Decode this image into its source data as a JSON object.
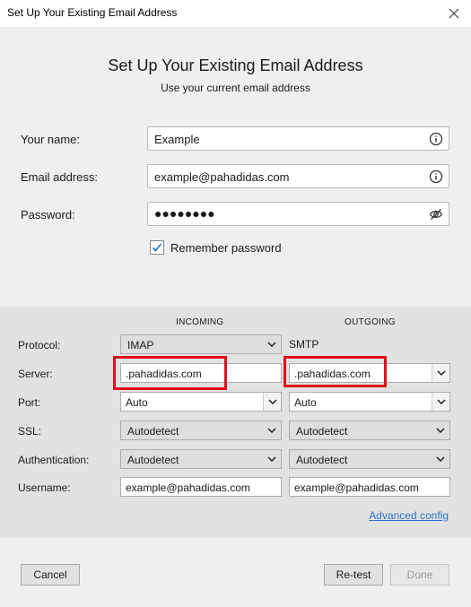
{
  "window": {
    "title": "Set Up Your Existing Email Address"
  },
  "header": {
    "title": "Set Up Your Existing Email Address",
    "subtitle": "Use your current email address"
  },
  "account": {
    "name_label": "Your name:",
    "name_value": "Example",
    "email_label": "Email address:",
    "email_value": "example@pahadidas.com",
    "password_label": "Password:",
    "password_value": "●●●●●●●●",
    "remember_label": "Remember password",
    "remember_checked": true
  },
  "server_config": {
    "incoming_header": "INCOMING",
    "outgoing_header": "OUTGOING",
    "rows": {
      "protocol": {
        "label": "Protocol:",
        "incoming": "IMAP",
        "outgoing": "SMTP"
      },
      "server": {
        "label": "Server:",
        "incoming": ".pahadidas.com",
        "outgoing": ".pahadidas.com"
      },
      "port": {
        "label": "Port:",
        "incoming": "Auto",
        "outgoing": "Auto"
      },
      "ssl": {
        "label": "SSL:",
        "incoming": "Autodetect",
        "outgoing": "Autodetect"
      },
      "authentication": {
        "label": "Authentication:",
        "incoming": "Autodetect",
        "outgoing": "Autodetect"
      },
      "username": {
        "label": "Username:",
        "incoming": "example@pahadidas.com",
        "outgoing": "example@pahadidas.com"
      }
    },
    "advanced_link": "Advanced config"
  },
  "footer": {
    "cancel": "Cancel",
    "retest": "Re-test",
    "done": "Done"
  },
  "colors": {
    "highlight": "#e0101a",
    "link": "#2a6fc9"
  }
}
